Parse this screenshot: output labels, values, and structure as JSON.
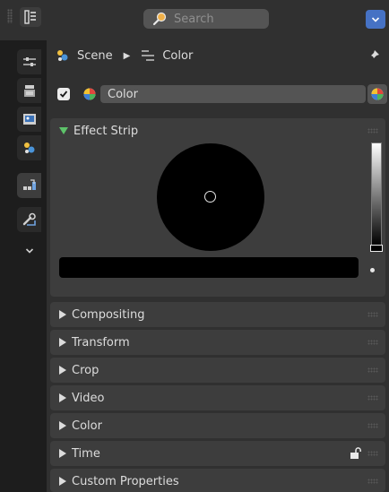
{
  "header": {
    "search_placeholder": "Search"
  },
  "breadcrumb": {
    "scene_label": "Scene",
    "strip_label": "Color"
  },
  "strip": {
    "enabled": true,
    "name": "Color"
  },
  "panels": {
    "effect_strip": {
      "label": "Effect Strip",
      "expanded": true
    },
    "compositing": {
      "label": "Compositing"
    },
    "transform": {
      "label": "Transform"
    },
    "crop": {
      "label": "Crop"
    },
    "video": {
      "label": "Video"
    },
    "color": {
      "label": "Color"
    },
    "time": {
      "label": "Time"
    },
    "custom_properties": {
      "label": "Custom Properties"
    }
  },
  "effect_color": {
    "hex": "#000000",
    "value": 0.0
  },
  "colors": {
    "accent_blue": "#4672c4",
    "expanded_triangle": "#5dc36a",
    "panel_bg": "#3d3d3d",
    "window_bg": "#303030"
  }
}
